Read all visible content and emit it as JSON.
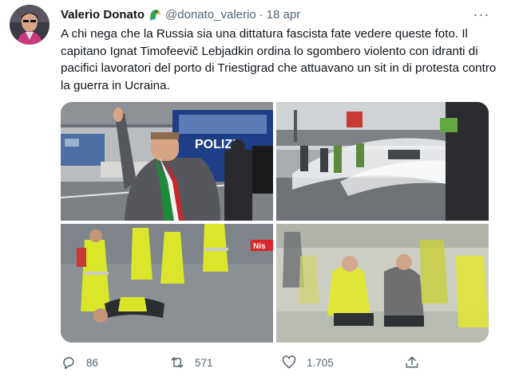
{
  "tweet": {
    "author_name": "Valerio Donato",
    "author_handle": "@donato_valerio",
    "separator": "·",
    "date": "18 apr",
    "more_label": "···",
    "text": "A chi nega che la Russia sia una dittatura fascista fate vedere queste foto. Il capitano Ignat Timofeevič Lebjadkin ordina lo sgombero violento con idranti di pacifici lavoratori del porto di Triestigrad che attuavano un sit in di protesta contro la guerra in Ucraina."
  },
  "media": {
    "photo1_van_text": "POLIZI",
    "photo3_logo": "Nis"
  },
  "actions": {
    "reply_count": "86",
    "retweet_count": "571",
    "like_count": "1.705"
  },
  "colors": {
    "text": "#0f1419",
    "secondary": "#536471",
    "accent": "#1d9bf0"
  },
  "icons": [
    "avatar",
    "parrot-emoji-icon",
    "more-icon",
    "reply-icon",
    "retweet-icon",
    "like-icon",
    "share-icon"
  ]
}
